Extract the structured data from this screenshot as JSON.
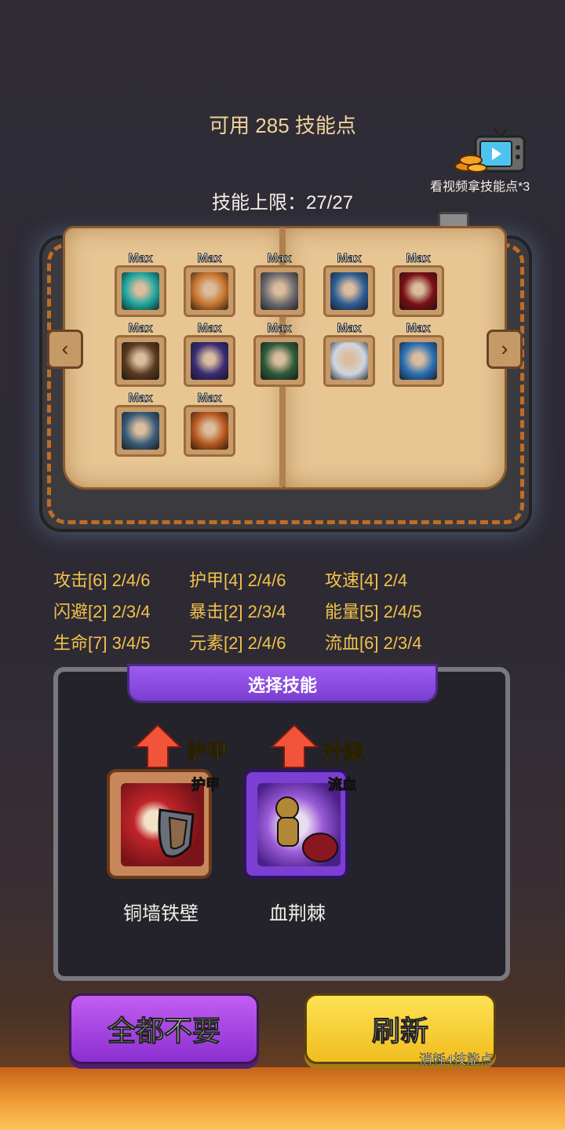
{
  "header": {
    "points_text": "可用 285 技能点",
    "limit_text": "技能上限：27/27",
    "video_reward_label": "看视频拿技能点*3"
  },
  "book": {
    "max_label": "Max",
    "skills": [
      {
        "icon": "teal-figure-icon",
        "color": "#1fa7a0"
      },
      {
        "icon": "two-figures-icon",
        "color": "#c8752e"
      },
      {
        "icon": "running-figure-icon",
        "color": "#6c6a6e"
      },
      {
        "icon": "starfield-icon",
        "color": "#2f5e96"
      },
      {
        "icon": "red-claw-icon",
        "color": "#7a1015"
      },
      {
        "icon": "brown-beast-icon",
        "color": "#5a3a20"
      },
      {
        "icon": "sleeping-blob-icon",
        "color": "#3a2c74"
      },
      {
        "icon": "red-spikes-icon",
        "color": "#2f5a3a"
      },
      {
        "icon": "ghost-figure-icon",
        "color": "#cfd6e0"
      },
      {
        "icon": "blue-eye-icon",
        "color": "#2a6fb4"
      },
      {
        "icon": "shadow-monster-icon",
        "color": "#3a5d7a"
      },
      {
        "icon": "explosion-icon",
        "color": "#b8581e"
      }
    ]
  },
  "stats": [
    "攻击[6] 2/4/6",
    "护甲[4] 2/4/6",
    "攻速[4] 2/4",
    "闪避[2] 2/3/4",
    "暴击[2] 2/3/4",
    "能量[5] 2/4/5",
    "生命[7] 3/4/5",
    "元素[2] 2/4/6",
    "流血[6] 2/3/4"
  ],
  "select_panel": {
    "title": "选择技能",
    "cards": [
      {
        "upgrade_label": "护甲",
        "tag": "护甲",
        "name": "铜墙铁壁",
        "icon": "shield-burst-icon"
      },
      {
        "upgrade_label": "升级",
        "tag": "流血",
        "name": "血荆棘",
        "icon": "bleeding-figure-icon"
      }
    ]
  },
  "buttons": {
    "skip_label": "全都不要",
    "refresh_label": "刷新",
    "refresh_cost": "消耗4技能点"
  }
}
